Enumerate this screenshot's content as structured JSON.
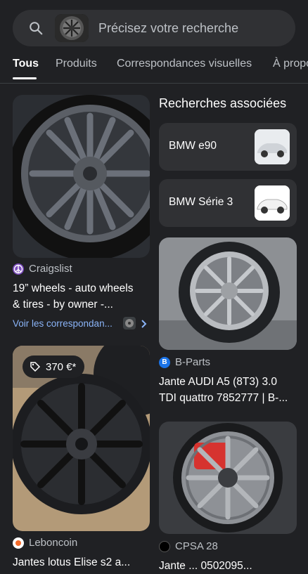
{
  "search": {
    "placeholder": "Précisez votre recherche"
  },
  "tabs": [
    {
      "label": "Tous",
      "active": true
    },
    {
      "label": "Produits"
    },
    {
      "label": "Correspondances visuelles"
    },
    {
      "label": "À propos"
    }
  ],
  "left_results": [
    {
      "source": "Craigslist",
      "title_line1": "19” wheels - auto wheels",
      "title_line2": "& tires - by owner -...",
      "visual_link": "Voir les correspondan..."
    },
    {
      "source": "Leboncoin",
      "price": "370 €*",
      "title_line1": "Jantes lotus Elise s2 a..."
    }
  ],
  "related": {
    "heading": "Recherches associées",
    "chips": [
      {
        "label": "BMW e90"
      },
      {
        "label": "BMW Série 3"
      }
    ]
  },
  "right_results": [
    {
      "source": "B-Parts",
      "title_line1": "Jante AUDI A5 (8T3) 3.0",
      "title_line2": "TDI quattro 7852777 | B-..."
    },
    {
      "source": "CPSA 28",
      "title_line1": "Jante ... 0502095..."
    }
  ],
  "colors": {
    "bg": "#202124",
    "link": "#8ab4f8",
    "craigslist": "#7c4dbd",
    "bparts": "#1a73e8",
    "leboncoin": "#f56b2a"
  }
}
